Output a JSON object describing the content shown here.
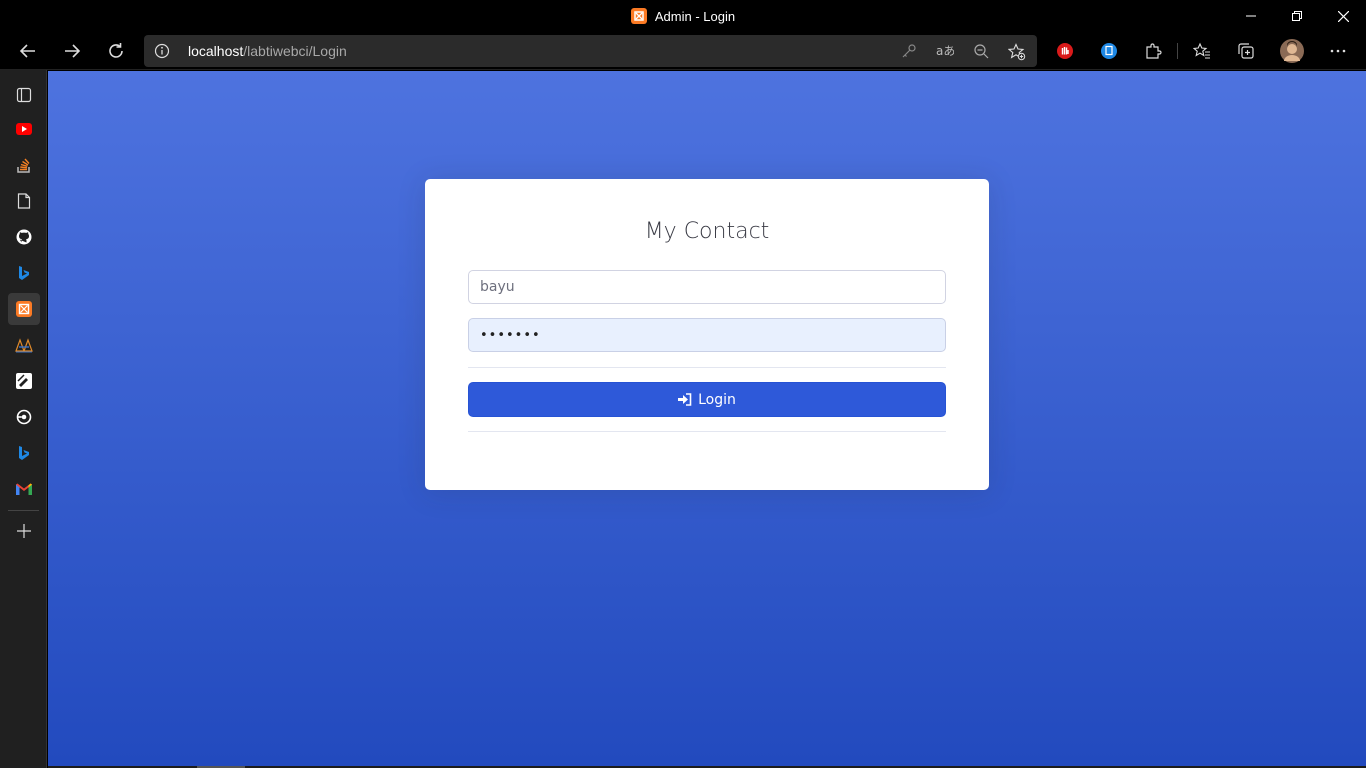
{
  "window": {
    "title": "Admin - Login"
  },
  "browser": {
    "url_host": "localhost",
    "url_path": "/labtiwebci/Login"
  },
  "sidebar": {
    "items": [
      {
        "name": "tab-actions-icon"
      },
      {
        "name": "youtube-icon",
        "color": "#ff0000"
      },
      {
        "name": "stackoverflow-icon",
        "color": "#f48024"
      },
      {
        "name": "document-icon"
      },
      {
        "name": "github-icon"
      },
      {
        "name": "bing-icon",
        "color": "#1e88e5"
      },
      {
        "name": "xampp-icon",
        "color": "#fb7a24"
      },
      {
        "name": "app-icon"
      },
      {
        "name": "edit-app-icon"
      },
      {
        "name": "circle-app-icon"
      },
      {
        "name": "bing-icon-2",
        "color": "#1e88e5"
      },
      {
        "name": "gmail-icon"
      }
    ]
  },
  "login": {
    "title": "My Contact",
    "username_value": "bayu",
    "password_value": "•••••••",
    "button_label": "Login"
  },
  "colors": {
    "gradient_top": "#4e73df",
    "gradient_bottom": "#224abe",
    "button": "#2e59d9"
  }
}
